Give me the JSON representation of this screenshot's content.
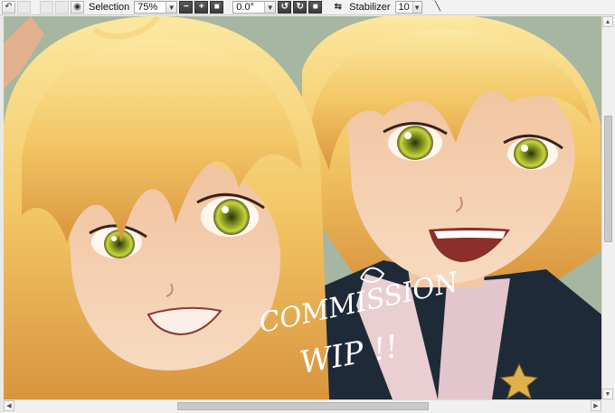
{
  "toolbar": {
    "selection_label": "Selection",
    "zoom_value": "75%",
    "rotation_value": "0.0°",
    "stabilizer_label": "Stabilizer",
    "stabilizer_value": "10",
    "icons": [
      "undo-icon",
      "blank-icon",
      "blank-icon",
      "blank-icon",
      "eye-icon",
      "zoom-out-icon",
      "zoom-in-icon",
      "zoom-reset-icon",
      "rotate-ccw-icon",
      "rotate-cw-icon",
      "rotate-reset-icon",
      "swap-icon",
      "line-tool-icon"
    ]
  },
  "canvas": {
    "artwork_text_line1": "COMMISSION",
    "artwork_text_line2": "WIP !!",
    "background_color": "#a7b6a0"
  },
  "colors": {
    "hair": "#f3c766",
    "skin": "#f6d2b3",
    "eyes": "#b8c92e",
    "jacket": "#1f2a38"
  }
}
